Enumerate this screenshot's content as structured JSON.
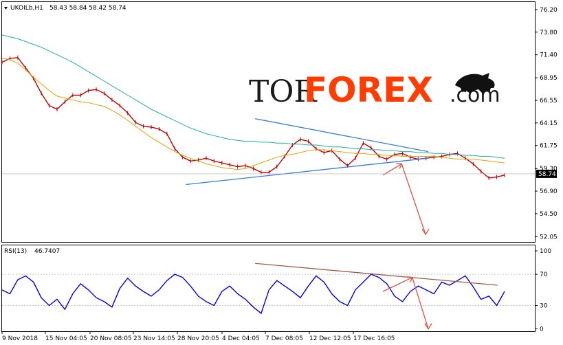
{
  "chart_data": [
    {
      "type": "line",
      "title": "UKOILb,H1  58.43 58.84 58.42 58.74",
      "symbol": "UKOILb,H1",
      "ohlc_text": "58.43 58.84 58.42 58.74",
      "current_price": "58.74",
      "ylim": [
        51.5,
        77.0
      ],
      "y_ticks": [
        "76.20",
        "73.80",
        "71.40",
        "68.95",
        "66.55",
        "64.15",
        "61.75",
        "59.30",
        "56.90",
        "54.50",
        "52.05"
      ],
      "series": [
        {
          "name": "",
          "color": "#c00000",
          "values": [
            70.6,
            71.0,
            71.1,
            70.0,
            68.9,
            67.3,
            66.0,
            65.6,
            66.4,
            67.1,
            67.1,
            67.6,
            67.7,
            67.3,
            66.6,
            66.0,
            65.2,
            64.2,
            63.8,
            63.7,
            63.5,
            63.0,
            61.4,
            60.5,
            60.1,
            60.2,
            60.4,
            60.1,
            59.9,
            59.7,
            59.5,
            59.6,
            59.3,
            58.9,
            58.9,
            59.5,
            60.6,
            61.8,
            62.4,
            62.2,
            61.4,
            61.0,
            61.2,
            60.3,
            59.6,
            60.4,
            62.0,
            61.5,
            60.6,
            60.3,
            60.8,
            60.9,
            60.5,
            60.3,
            60.4,
            60.5,
            60.6,
            60.8,
            60.9,
            60.4,
            59.8,
            59.0,
            58.3,
            58.4,
            58.6
          ]
        },
        {
          "name": "",
          "color": "#e8a000",
          "values": [
            71.0,
            70.9,
            70.5,
            69.8,
            69.0,
            68.3,
            67.6,
            67.0,
            66.8,
            66.6,
            66.4,
            66.3,
            66.1,
            65.9,
            65.5,
            65.0,
            64.4,
            63.8,
            63.2,
            62.6,
            62.1,
            61.6,
            61.1,
            60.7,
            60.4,
            60.1,
            59.8,
            59.6,
            59.4,
            59.3,
            59.2,
            59.3,
            59.6,
            59.9,
            60.2,
            60.5,
            60.7,
            60.8,
            61.0,
            61.2,
            61.3,
            61.3,
            61.2,
            61.1,
            61.0,
            60.9,
            60.9,
            60.8,
            60.8,
            60.7,
            60.7,
            60.6,
            60.6,
            60.6,
            60.6,
            60.6,
            60.5,
            60.4,
            60.3,
            60.3,
            60.3,
            60.2,
            60.1,
            60.0,
            59.9
          ]
        },
        {
          "name": "",
          "color": "#20b0a0",
          "values": [
            73.5,
            73.3,
            73.1,
            72.8,
            72.5,
            72.2,
            71.8,
            71.4,
            71.0,
            70.6,
            70.1,
            69.6,
            69.1,
            68.6,
            68.1,
            67.6,
            67.1,
            66.6,
            66.1,
            65.6,
            65.2,
            64.8,
            64.4,
            64.0,
            63.6,
            63.3,
            63.0,
            62.8,
            62.6,
            62.4,
            62.3,
            62.2,
            62.2,
            62.1,
            62.1,
            62.0,
            62.0,
            61.9,
            61.9,
            61.8,
            61.8,
            61.7,
            61.6,
            61.6,
            61.5,
            61.4,
            61.4,
            61.3,
            61.3,
            61.2,
            61.2,
            61.1,
            61.1,
            61.0,
            61.0,
            60.9,
            60.9,
            60.8,
            60.8,
            60.7,
            60.7,
            60.6,
            60.6,
            60.5,
            60.4
          ]
        }
      ],
      "trendlines": [
        {
          "color": "#3a7be0",
          "from": [
            47.5,
            64.6
          ],
          "to": [
            80.0,
            61.1
          ]
        },
        {
          "color": "#3a7be0",
          "from": [
            34.5,
            57.6
          ],
          "to": [
            80.0,
            60.4
          ]
        },
        {
          "color": "#e74c3c",
          "from": [
            71.5,
            58.6
          ],
          "to": [
            75.0,
            59.8
          ]
        },
        {
          "color": "#e74c3c",
          "from": [
            75.0,
            59.8
          ],
          "to": [
            79.5,
            52.3
          ]
        }
      ]
    },
    {
      "type": "line",
      "title": "RSI(13) 46.7407",
      "indicator": "RSI(13)",
      "value_text": "46.7407",
      "ylim": [
        -3,
        108
      ],
      "y_ticks": [
        "100",
        "70",
        "30",
        "0"
      ],
      "series": [
        {
          "name": "",
          "color": "#0000dd",
          "values": [
            50,
            45,
            63,
            68,
            60,
            40,
            30,
            38,
            25,
            45,
            58,
            50,
            40,
            35,
            28,
            52,
            65,
            55,
            48,
            42,
            50,
            62,
            70,
            66,
            55,
            42,
            35,
            30,
            48,
            55,
            45,
            38,
            28,
            20,
            50,
            62,
            55,
            48,
            40,
            55,
            68,
            60,
            45,
            35,
            30,
            50,
            60,
            70,
            66,
            58,
            42,
            35,
            48,
            55,
            50,
            45,
            60,
            56,
            62,
            68,
            54,
            38,
            42,
            30,
            48
          ]
        }
      ],
      "trendlines": [
        {
          "color": "#a05a4a",
          "from": [
            47.5,
            84
          ],
          "to": [
            93.0,
            56
          ]
        },
        {
          "color": "#e74c3c",
          "from": [
            71.5,
            48
          ],
          "to": [
            77.0,
            66
          ]
        },
        {
          "color": "#e74c3c",
          "from": [
            77.0,
            66
          ],
          "to": [
            80.0,
            0
          ]
        }
      ]
    }
  ],
  "x_ticks": [
    "9 Nov 2018",
    "15 Nov 04:05",
    "20 Nov 08:05",
    "23 Nov 14:05",
    "28 Nov 20:05",
    "4 Dec 04:05",
    "7 Dec 08:05",
    "12 Dec 12:05",
    "17 Dec 16:05"
  ],
  "watermark": {
    "tor": "TOR",
    "forex": "FOREX",
    "com": ".com"
  }
}
